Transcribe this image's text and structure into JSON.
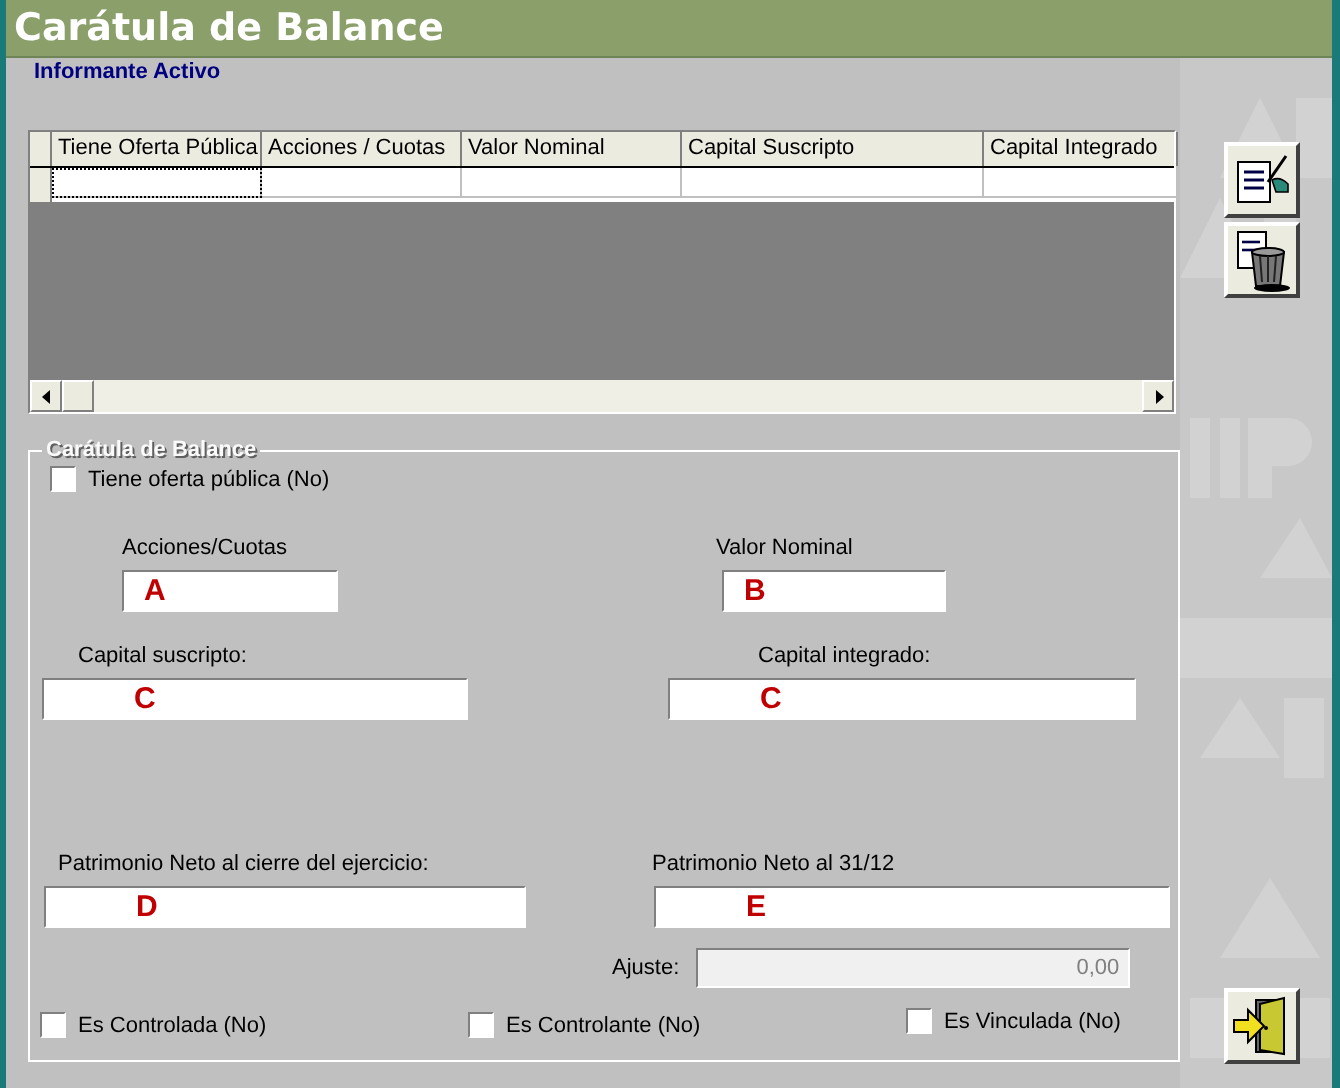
{
  "window": {
    "title": "Carátula de Balance"
  },
  "subtitle": "Informante Activo",
  "table": {
    "columns": [
      "Tiene Oferta Pública",
      "Acciones / Cuotas",
      "Valor Nominal",
      "Capital Suscripto",
      "Capital Integrado"
    ]
  },
  "group": {
    "title": "Carátula de Balance",
    "oferta": {
      "label": "Tiene oferta pública  (No)",
      "checked": false
    },
    "rows": [
      [
        {
          "label": "Acciones/Cuotas",
          "value": "A"
        },
        {
          "label": "Valor Nominal",
          "value": "B"
        }
      ],
      [
        {
          "label": "Capital suscripto:",
          "value": "C"
        },
        {
          "label": "Capital integrado:",
          "value": "C"
        }
      ],
      [
        {
          "label": "Patrimonio Neto al cierre del ejercicio:",
          "value": "D"
        },
        {
          "label": "Patrimonio Neto al 31/12",
          "value": "E"
        }
      ]
    ],
    "ajuste": {
      "label": "Ajuste:",
      "value": "0,00",
      "disabled": true
    },
    "checks": [
      {
        "label": "Es Controlada  (No)",
        "checked": false
      },
      {
        "label": "Es Controlante  (No)",
        "checked": false
      },
      {
        "label": "Es Vinculada  (No)",
        "checked": false
      }
    ]
  }
}
